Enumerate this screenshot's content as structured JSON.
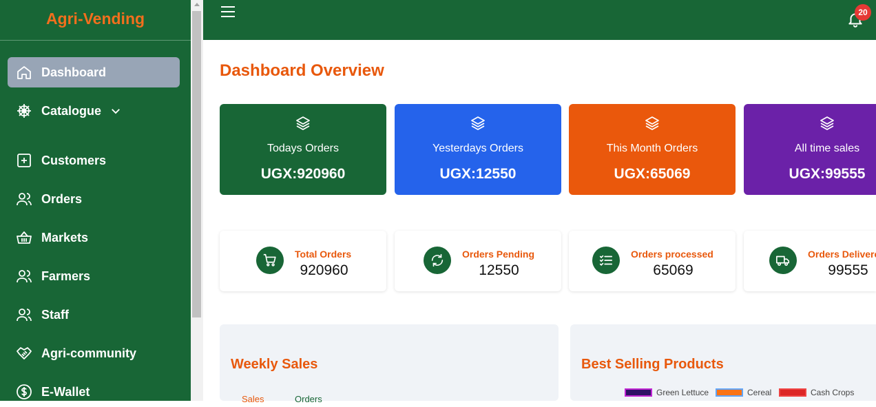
{
  "app": {
    "title": "Agri-Vending"
  },
  "sidebar": {
    "items": [
      {
        "label": "Dashboard"
      },
      {
        "label": "Catalogue"
      },
      {
        "label": "Customers"
      },
      {
        "label": "Orders"
      },
      {
        "label": "Markets"
      },
      {
        "label": "Farmers"
      },
      {
        "label": "Staff"
      },
      {
        "label": "Agri-community"
      },
      {
        "label": "E-Wallet"
      }
    ]
  },
  "header": {
    "notification_count": "20"
  },
  "main": {
    "title": "Dashboard Overview",
    "stat_cards": [
      {
        "label": "Todays Orders",
        "value": "UGX:920960",
        "color": "#186636"
      },
      {
        "label": "Yesterdays Orders",
        "value": "UGX:12550",
        "color": "#2563eb"
      },
      {
        "label": "This Month Orders",
        "value": "UGX:65069",
        "color": "#ea580c"
      },
      {
        "label": "All time sales",
        "value": "UGX:99555",
        "color": "#6b21a8"
      }
    ],
    "summary_cards": [
      {
        "label": "Total Orders",
        "value": "920960",
        "icon": "cart-icon"
      },
      {
        "label": "Orders Pending",
        "value": "12550",
        "icon": "refresh-icon"
      },
      {
        "label": "Orders processed",
        "value": "65069",
        "icon": "checklist-icon"
      },
      {
        "label": "Orders Delivered",
        "value": "99555",
        "icon": "truck-icon"
      }
    ],
    "weekly_sales": {
      "title": "Weekly Sales",
      "tabs": [
        {
          "label": "Sales"
        },
        {
          "label": "Orders"
        }
      ]
    },
    "best_selling": {
      "title": "Best Selling Products",
      "legend": [
        {
          "label": "Green Lettuce",
          "color": "#2e1065"
        },
        {
          "label": "Cereal",
          "color": "#f97316"
        },
        {
          "label": "Cash Crops",
          "color": "#dc2626"
        }
      ]
    }
  }
}
